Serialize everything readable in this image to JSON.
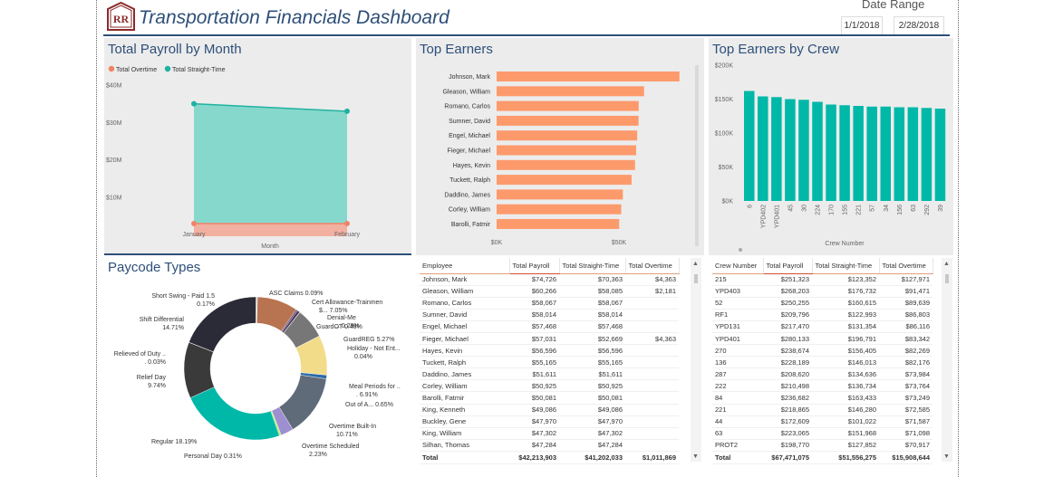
{
  "header": {
    "title": "Transportation Financials Dashboard",
    "logo_text": "RR",
    "date_range_label": "Date Range",
    "date_start": "1/1/2018",
    "date_end": "2/28/2018"
  },
  "colors": {
    "overtime": "#f08366",
    "straight_time": "#20b2a0",
    "bar": "#fd9a6c",
    "crew_bar": "#00b8a8",
    "title": "#2e4f79"
  },
  "payroll_panel": {
    "title": "Total Payroll by Month",
    "legend": [
      "Total Overtime",
      "Total Straight-Time"
    ]
  },
  "payroll_chart": {
    "type": "area",
    "categories": [
      "January",
      "February"
    ],
    "series": [
      {
        "name": "Total Overtime",
        "values": [
          0.0,
          0.0
        ]
      },
      {
        "name": "Total Straight-Time",
        "values": [
          35.0,
          33.0
        ]
      }
    ],
    "yticks": [
      "$10M",
      "$20M",
      "$30M",
      "$40M"
    ],
    "xlabel": "Month",
    "ylim": [
      0,
      40
    ]
  },
  "earners_panel": {
    "title": "Top Earners"
  },
  "earners_chart": {
    "type": "bar",
    "categories": [
      "Johnson, Mark",
      "Gleason, William",
      "Romano, Carlos",
      "Sumner, David",
      "Engel, Michael",
      "Fieger, Michael",
      "Hayes, Kevin",
      "Tuckett, Ralph",
      "Daddino, James",
      "Corley, William",
      "Barolli, Fatmir"
    ],
    "values": [
      74726,
      60266,
      58067,
      58014,
      57468,
      57031,
      56596,
      55165,
      51611,
      50925,
      50081
    ],
    "xticks": [
      "$0K",
      "$50K"
    ]
  },
  "crew_panel": {
    "title": "Top Earners by Crew"
  },
  "crew_chart": {
    "type": "bar",
    "categories": [
      "6",
      "YPD402",
      "YPD401",
      "45",
      "30",
      "224",
      "170",
      "155",
      "221",
      "57",
      "34",
      "156",
      "63",
      "292",
      "39"
    ],
    "values": [
      162000,
      154000,
      153000,
      150000,
      149000,
      146000,
      142000,
      141000,
      140000,
      139000,
      139000,
      138000,
      138000,
      137000,
      136000
    ],
    "yticks": [
      "$0K",
      "$50K",
      "$100K",
      "$150K",
      "$200K"
    ],
    "xlabel": "Crew Number",
    "ylim": [
      0,
      200000
    ]
  },
  "paycode_panel": {
    "title": "Paycode Types"
  },
  "paycode_chart": {
    "type": "pie",
    "slices": [
      {
        "name": "ASC Claims",
        "value": 0.09,
        "label": "ASC Claims 0.09%",
        "color": "#c8c8c8"
      },
      {
        "name": "Cert Allowance-Trainmen",
        "value": 7.05,
        "label": "Cert Allowance-Trainmen $... 7.05%",
        "color": "#b87350"
      },
      {
        "name": "Denial-Me...",
        "value": 0.29,
        "label": "Denial-Me... 0.29%",
        "color": "#6a4f7a"
      },
      {
        "name": "GuardOT",
        "value": 0.48,
        "label": "GuardOT 0.48%",
        "color": "#4f3a60"
      },
      {
        "name": "Holiday - Not Ent...",
        "value": 0.04,
        "label": "Holiday - Not Ent... 0.04%",
        "color": "#e6e64c"
      },
      {
        "name": "GuardREG",
        "value": 5.27,
        "label": "GuardREG 5.27%",
        "color": "#777777"
      },
      {
        "name": "Meal Periods for ...",
        "value": 6.91,
        "label": "Meal Periods for ... 6.91%",
        "color": "#f2dc8a"
      },
      {
        "name": "Out of A...",
        "value": 0.65,
        "label": "Out of A... 0.65%",
        "color": "#2a6ba8"
      },
      {
        "name": "Overtime Built-In",
        "value": 10.71,
        "label": "Overtime Built-In 10.71%",
        "color": "#5f6b78"
      },
      {
        "name": "Overtime Scheduled",
        "value": 2.23,
        "label": "Overtime Scheduled 2.23%",
        "color": "#9d8fd0"
      },
      {
        "name": "Personal Day",
        "value": 0.31,
        "label": "Personal Day 0.31%",
        "color": "#b6f060"
      },
      {
        "name": "Regular",
        "value": 18.19,
        "label": "Regular 18.19%",
        "color": "#00b8a8"
      },
      {
        "name": "Relief Day",
        "value": 9.74,
        "label": "Relief Day 9.74%",
        "color": "#3a3a3a"
      },
      {
        "name": "Relieved of Duty ...",
        "value": 0.03,
        "label": "Relieved of Duty ... 0.03%",
        "color": "#aaaaaa"
      },
      {
        "name": "Shift Differential",
        "value": 14.71,
        "label": "Shift Differential 14.71%",
        "color": "#2b2b38"
      },
      {
        "name": "Short Swing - Paid 1.5",
        "value": 0.17,
        "label": "Short Swing - Paid 1.5 0.17%",
        "color": "#a0a0a0"
      }
    ]
  },
  "employee_table": {
    "columns": [
      "Employee",
      "Total Payroll",
      "Total Straight-Time",
      "Total Overtime"
    ],
    "rows": [
      [
        "Johnson, Mark",
        "$74,726",
        "$70,363",
        "$4,363"
      ],
      [
        "Gleason, William",
        "$60,266",
        "$58,085",
        "$2,181"
      ],
      [
        "Romano, Carlos",
        "$58,067",
        "$58,067",
        ""
      ],
      [
        "Sumner, David",
        "$58,014",
        "$58,014",
        ""
      ],
      [
        "Engel, Michael",
        "$57,468",
        "$57,468",
        ""
      ],
      [
        "Fieger, Michael",
        "$57,031",
        "$52,669",
        "$4,363"
      ],
      [
        "Hayes, Kevin",
        "$56,596",
        "$56,596",
        ""
      ],
      [
        "Tuckett, Ralph",
        "$55,165",
        "$55,165",
        ""
      ],
      [
        "Daddino, James",
        "$51,611",
        "$51,611",
        ""
      ],
      [
        "Corley, William",
        "$50,925",
        "$50,925",
        ""
      ],
      [
        "Barolli, Fatmir",
        "$50,081",
        "$50,081",
        ""
      ],
      [
        "King, Kenneth",
        "$49,086",
        "$49,086",
        ""
      ],
      [
        "Buckley, Gene",
        "$47,970",
        "$47,970",
        ""
      ],
      [
        "King, William",
        "$47,302",
        "$47,302",
        ""
      ],
      [
        "Silhan, Thomas",
        "$47,284",
        "$47,284",
        ""
      ]
    ],
    "total": [
      "Total",
      "$42,213,903",
      "$41,202,033",
      "$1,011,869"
    ]
  },
  "crew_table": {
    "columns": [
      "Crew Number",
      "Total Payroll",
      "Total Straight-Time",
      "Total Overtime"
    ],
    "rows": [
      [
        "215",
        "$251,323",
        "$123,352",
        "$127,971"
      ],
      [
        "YPD403",
        "$268,203",
        "$176,732",
        "$91,471"
      ],
      [
        "52",
        "$250,255",
        "$160,615",
        "$89,639"
      ],
      [
        "RF1",
        "$209,796",
        "$122,993",
        "$86,803"
      ],
      [
        "YPD131",
        "$217,470",
        "$131,354",
        "$86,116"
      ],
      [
        "YPD401",
        "$280,133",
        "$196,791",
        "$83,342"
      ],
      [
        "270",
        "$238,674",
        "$156,405",
        "$82,269"
      ],
      [
        "136",
        "$228,189",
        "$146,013",
        "$82,176"
      ],
      [
        "287",
        "$208,620",
        "$134,636",
        "$73,984"
      ],
      [
        "222",
        "$210,498",
        "$136,734",
        "$73,764"
      ],
      [
        "84",
        "$236,682",
        "$163,433",
        "$73,249"
      ],
      [
        "221",
        "$218,865",
        "$146,280",
        "$72,585"
      ],
      [
        "44",
        "$172,609",
        "$101,022",
        "$71,587"
      ],
      [
        "63",
        "$223,065",
        "$151,968",
        "$71,098"
      ],
      [
        "PROT2",
        "$198,770",
        "$127,852",
        "$70,917"
      ]
    ],
    "total": [
      "Total",
      "$67,471,075",
      "$51,556,275",
      "$15,908,644"
    ]
  }
}
